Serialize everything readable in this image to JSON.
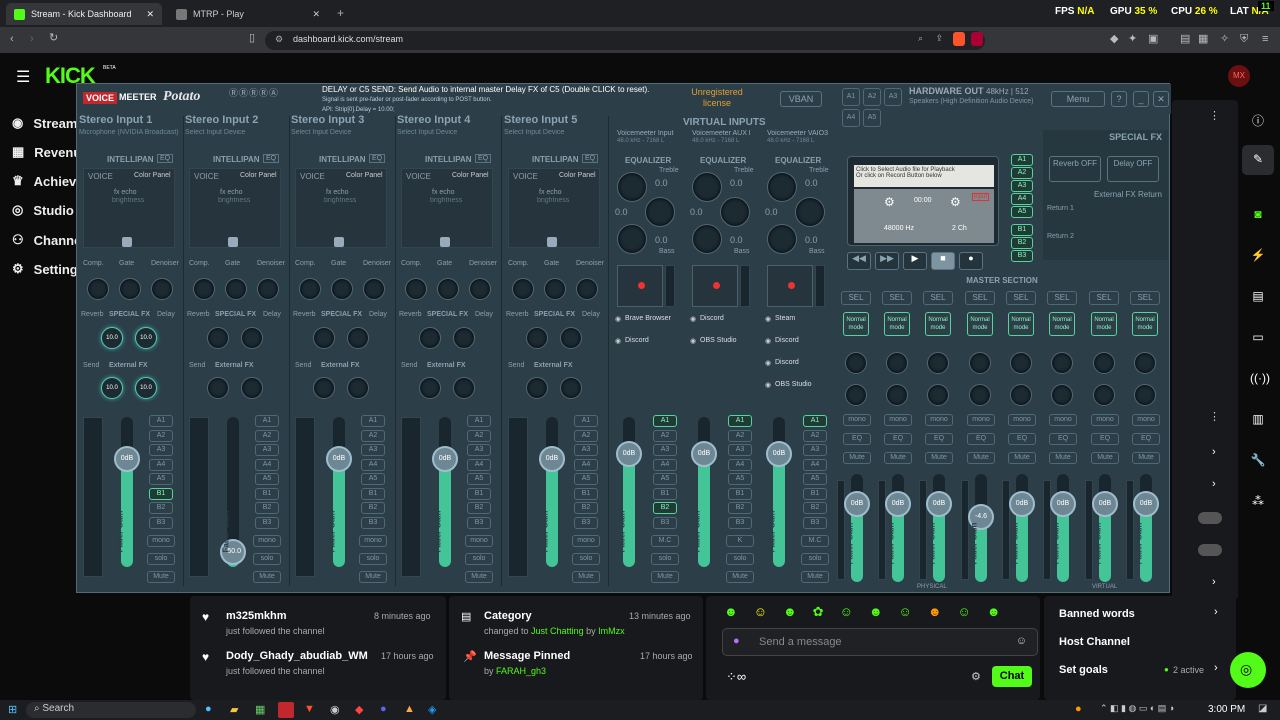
{
  "browser": {
    "tabs": [
      {
        "label": "Stream - Kick Dashboard",
        "active": true,
        "color": "#53fc18"
      },
      {
        "label": "MTRP - Play",
        "active": false,
        "color": "#888888"
      }
    ],
    "url": "dashboard.kick.com/stream",
    "hud": {
      "fps": "FPS",
      "fps_val": "N/A",
      "gpu": "GPU",
      "gpu_val": "35 %",
      "cpu": "CPU",
      "cpu_val": "26 %",
      "lat": "LAT",
      "lat_val": "N/A",
      "corner": "11"
    }
  },
  "kick": {
    "logo": "KICK",
    "beta": "BETA",
    "avatar": "MX",
    "sidebar": [
      "Stream",
      "Revenue",
      "Achievements",
      "Studio",
      "Channel",
      "Settings"
    ],
    "feed": [
      {
        "title": "m325mkhm",
        "sub": "just followed the channel",
        "time": "8 minutes ago"
      },
      {
        "title": "Dody_Ghady_abudiab_WM",
        "sub": "just followed the channel",
        "time": "17 hours ago"
      }
    ],
    "activity": [
      {
        "title": "Category",
        "sub_pre": "changed to ",
        "highlight": "Just Chatting",
        "sub_mid": " by ",
        "user": "ImMzx",
        "time": "13 minutes ago"
      },
      {
        "title": "Message Pinned",
        "sub_pre": "by ",
        "highlight": "",
        "sub_mid": "",
        "user": "FARAH_gh3",
        "time": "17 hours ago"
      }
    ],
    "chat_placeholder": "Send a message",
    "chat_button": "Chat",
    "settings_links": [
      "Banned words",
      "Host Channel",
      "Set goals"
    ],
    "goals_status": "2 active"
  },
  "vm": {
    "brand_a": "VOICE",
    "brand_b": "MEETER",
    "brand_c": "Potato",
    "info_1": "DELAY or C5 SEND: Send Audio to internal master Delay FX of C5 (Double CLICK to reset).",
    "info_2": "Signal is sent pre-fader or post-fader according to POST button.",
    "info_3": "API: Strip[0].Delay = 10.00;",
    "license": "Unregistered license",
    "vban": "VBAN",
    "hw_out": "HARDWARE OUT",
    "hw_rate": "48kHz | 512",
    "hw_dev": "Speakers (High Definition Audio Device)",
    "menu": "Menu",
    "inputs": [
      {
        "title": "Stereo Input 1",
        "device": "Microphone (NVIDIA Broadcast)",
        "fader": "0dB",
        "level": 0.72
      },
      {
        "title": "Stereo Input 2",
        "device": "Select Input Device",
        "fader": "-60.0",
        "level": 0.1
      },
      {
        "title": "Stereo Input 3",
        "device": "Select Input Device",
        "fader": "0dB",
        "level": 0.72
      },
      {
        "title": "Stereo Input 4",
        "device": "Select Input Device",
        "fader": "0dB",
        "level": 0.72
      },
      {
        "title": "Stereo Input 5",
        "device": "Select Input Device",
        "fader": "0dB",
        "level": 0.72
      }
    ],
    "virtual_title": "VIRTUAL INPUTS",
    "virtuals": [
      {
        "title": "Voicemeeter Input",
        "rate": "48.0 kHz - 7168 L",
        "apps": [
          "Brave Browser",
          "Discord"
        ]
      },
      {
        "title": "Voicemeeter AUX I",
        "rate": "48.0 kHz - 7168 L",
        "apps": [
          "Discord",
          "OBS Studio"
        ]
      },
      {
        "title": "Voicemeeter VAIO3",
        "rate": "48.0 kHz - 7168 L",
        "apps": [
          "Steam",
          "Discord",
          "Discord",
          "OBS Studio"
        ]
      }
    ],
    "labels": {
      "intellipan": "INTELLIPAN",
      "eq": "EQ",
      "voice": "VOICE",
      "color_panel": "Color Panel",
      "fx_echo": "fx echo",
      "brightness": "brightness",
      "comp": "Comp.",
      "gate": "Gate",
      "denoiser": "Denoiser",
      "reverb": "Reverb",
      "special_fx": "SPECIAL FX",
      "delay": "Delay",
      "external_fx": "External FX",
      "send": "Send",
      "equalizer": "EQUALIZER",
      "treble": "Treble",
      "bass": "Bass",
      "fader_gain": "Fader Gain",
      "mono": "mono",
      "solo": "solo",
      "mute": "Mute",
      "mc": "M.C",
      "k": "K",
      "knob_val": "10.0",
      "zero": "0.0"
    },
    "routing": [
      "A1",
      "A2",
      "A3",
      "A4",
      "A5",
      "B1",
      "B2",
      "B3"
    ],
    "player": {
      "hint_1": "Click to Select Audio file for Playback",
      "hint_2": "Or click on Record Button below",
      "time": "00:00",
      "rate": "48000 Hz",
      "ch": "2 Ch",
      "input": "input"
    },
    "special_fx_title": "SPECIAL FX",
    "reverb_btn": "Reverb OFF",
    "delay_btn": "Delay OFF",
    "ext_return": "External FX Return",
    "return1": "Return 1",
    "return2": "Return 2",
    "master_title": "MASTER SECTION",
    "master_sel": "SEL",
    "master_mode": "Normal mode",
    "master_faders": [
      "0dB",
      "0dB",
      "0dB",
      "-4.6",
      "0dB",
      "0dB",
      "0dB",
      "0dB"
    ],
    "master_levels": [
      0.72,
      0.72,
      0.72,
      0.6,
      0.72,
      0.72,
      0.72,
      0.72
    ],
    "physical": "PHYSICAL",
    "virtual": "VIRTUAL"
  },
  "taskbar": {
    "search": "Search",
    "time": "3:00 PM"
  }
}
